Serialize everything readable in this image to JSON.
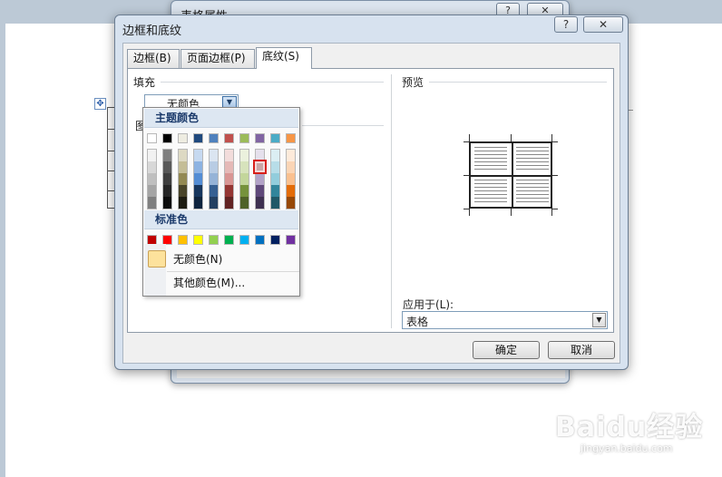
{
  "back_dialog": {
    "title": "表格属性",
    "help_label": "?",
    "close_label": "✕"
  },
  "dialog": {
    "title": "边框和底纹",
    "help_label": "?",
    "close_label": "✕",
    "tabs": [
      {
        "label": "边框(B)",
        "active": false
      },
      {
        "label": "页面边框(P)",
        "active": false
      },
      {
        "label": "底纹(S)",
        "active": true
      }
    ],
    "fill": {
      "label": "填充",
      "value": "无颜色"
    },
    "pattern_label": "图",
    "preview_label": "预览",
    "apply": {
      "label": "应用于(L):",
      "value": "表格"
    },
    "ok_label": "确定",
    "cancel_label": "取消"
  },
  "color_picker": {
    "theme_header": "主题颜色",
    "standard_header": "标准色",
    "no_color_label": "无颜色(N)",
    "more_colors_label": "其他颜色(M)...",
    "theme_top": [
      "#ffffff",
      "#000000",
      "#eeece1",
      "#1f497d",
      "#4f81bd",
      "#c0504d",
      "#9bbb59",
      "#8064a2",
      "#4bacc6",
      "#f79646"
    ],
    "theme_columns": [
      [
        "#f2f2f2",
        "#d8d8d8",
        "#bfbfbf",
        "#a5a5a5",
        "#7f7f7f"
      ],
      [
        "#7f7f7f",
        "#595959",
        "#3f3f3f",
        "#262626",
        "#0c0c0c"
      ],
      [
        "#ddd9c3",
        "#c4bd97",
        "#938953",
        "#494429",
        "#1d1b10"
      ],
      [
        "#c6d9f0",
        "#8db3e2",
        "#548dd4",
        "#17365d",
        "#0f243e"
      ],
      [
        "#dbe5f1",
        "#b8cce4",
        "#95b3d7",
        "#366092",
        "#244061"
      ],
      [
        "#f2dcdb",
        "#e5b9b7",
        "#d99694",
        "#953734",
        "#632423"
      ],
      [
        "#ebf1dd",
        "#d7e3bc",
        "#c3d69b",
        "#76923c",
        "#4f6128"
      ],
      [
        "#e5e0ec",
        "#ccc1d9",
        "#b2a2c7",
        "#5f497a",
        "#3f3151"
      ],
      [
        "#dbeef3",
        "#b7dde8",
        "#92cddc",
        "#31859b",
        "#205867"
      ],
      [
        "#fdeada",
        "#fbd5b5",
        "#fac08f",
        "#e36c09",
        "#974806"
      ]
    ],
    "standard": [
      "#c00000",
      "#ff0000",
      "#ffc000",
      "#ffff00",
      "#92d050",
      "#00b050",
      "#00b0f0",
      "#0070c0",
      "#002060",
      "#7030a0"
    ]
  },
  "watermark": {
    "brand": "Baidu经验",
    "url": "jingyan.baidu.com"
  }
}
